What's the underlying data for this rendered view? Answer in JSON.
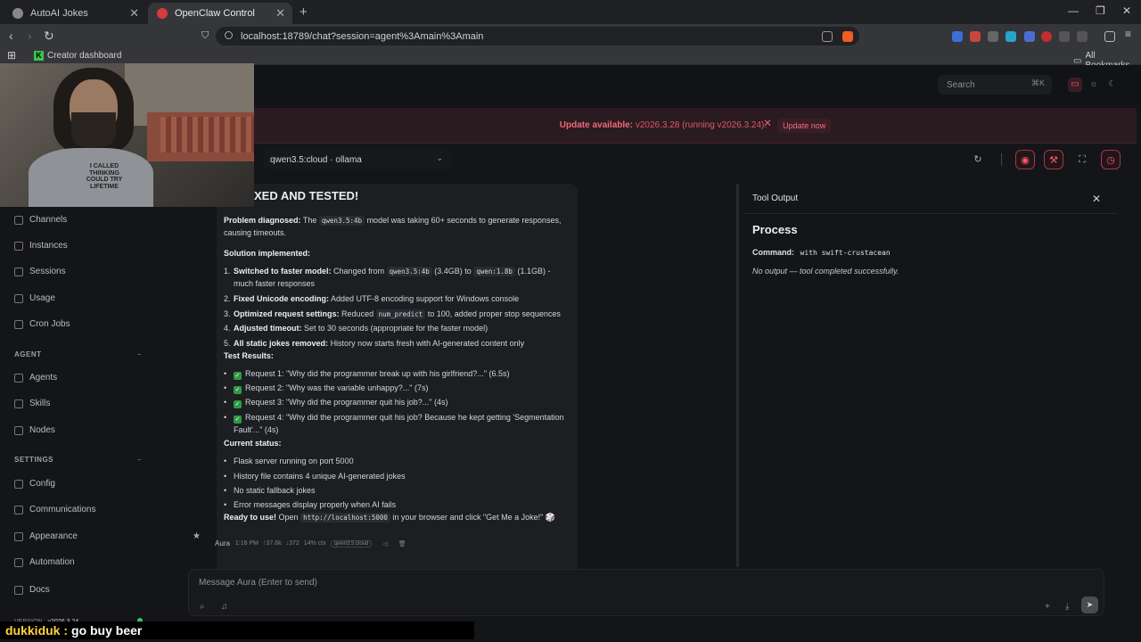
{
  "browser": {
    "tabs": [
      {
        "title": "AutoAI Jokes",
        "active": false
      },
      {
        "title": "OpenClaw Control",
        "active": true
      }
    ],
    "url": "localhost:18789/chat?session=agent%3Amain%3Amain",
    "bookmarks": {
      "creator": "Creator dashboard",
      "all": "All Bookmarks"
    }
  },
  "app": {
    "search": {
      "placeholder": "Search",
      "shortcut": "⌘K"
    },
    "update": {
      "label": "Update available:",
      "detail": "v2026.3.28 (running v2026.3.24).",
      "button": "Update now"
    },
    "model": "qwen3.5:cloud · ollama",
    "sidebar": {
      "items_top": [
        "Channels",
        "Instances",
        "Sessions",
        "Usage",
        "Cron Jobs"
      ],
      "agent_section": "AGENT",
      "agent_items": [
        "Agents",
        "Skills",
        "Nodes"
      ],
      "settings_section": "SETTINGS",
      "settings_items": [
        "Config",
        "Communications",
        "Appearance",
        "Automation",
        "Docs"
      ],
      "version_label": "VERSION",
      "version": "v2026.3.24"
    }
  },
  "message": {
    "heading": "XED AND TESTED!",
    "diag_label": "Problem diagnosed:",
    "diag_pre": "The",
    "diag_code": "qwen3.5:4b",
    "diag_post": "model was taking 60+ seconds to generate responses, causing timeouts.",
    "solution_label": "Solution implemented:",
    "steps": [
      {
        "n": "1.",
        "label": "Switched to faster model:",
        "a": "Changed from",
        "code1": "qwen3.5:4b",
        "b": "(3.4GB) to",
        "code2": "qwen:1.8b",
        "c": "(1.1GB) - much faster responses"
      },
      {
        "n": "2.",
        "label": "Fixed Unicode encoding:",
        "text": "Added UTF-8 encoding support for Windows console"
      },
      {
        "n": "3.",
        "label": "Optimized request settings:",
        "a": "Reduced",
        "code1": "num_predict",
        "c": "to 100, added proper stop sequences"
      },
      {
        "n": "4.",
        "label": "Adjusted timeout:",
        "text": "Set to 30 seconds (appropriate for the faster model)"
      },
      {
        "n": "5.",
        "label": "All static jokes removed:",
        "text": "History now starts fresh with AI-generated content only"
      }
    ],
    "test_label": "Test Results:",
    "tests": [
      "Request 1: \"Why did the programmer break up with his girlfriend?...\" (6.5s)",
      "Request 2: \"Why was the variable unhappy?...\" (7s)",
      "Request 3: \"Why did the programmer quit his job?...\" (4s)",
      "Request 4: \"Why did the programmer quit his job? Because he kept getting 'Segmentation Fault'...\" (4s)"
    ],
    "status_label": "Current status:",
    "status": [
      "Flask server running on port 5000",
      "History file contains 4 unique AI-generated jokes",
      "No static fallback jokes",
      "Error messages display properly when AI fails"
    ],
    "ready_label": "Ready to use!",
    "ready_pre": "Open",
    "ready_code": "http://localhost:5000",
    "ready_post": "in your browser and click \"Get Me a Joke!\" 🎲",
    "meta": {
      "sender": "Aura",
      "time": "1:16 PM",
      "in": "↑37.6k",
      "out": "↓372",
      "ctx": "14% ctx",
      "model": "qwen3.5:cloud"
    }
  },
  "tool": {
    "title": "Tool Output",
    "heading": "Process",
    "command_label": "Command:",
    "command": "with swift-crustacean",
    "output": "No output — tool completed successfully."
  },
  "composer": {
    "placeholder": "Message Aura (Enter to send)"
  },
  "overlay": {
    "shirt": "I CALLED THINKING COULD TRY LIFETIME",
    "chat_user": "dukkiduk :",
    "chat_text": "go buy beer"
  },
  "colors": {
    "accent": "#ff5a6e",
    "bg": "#141519",
    "panel": "#1d1e22",
    "ok": "#2e9a45"
  }
}
